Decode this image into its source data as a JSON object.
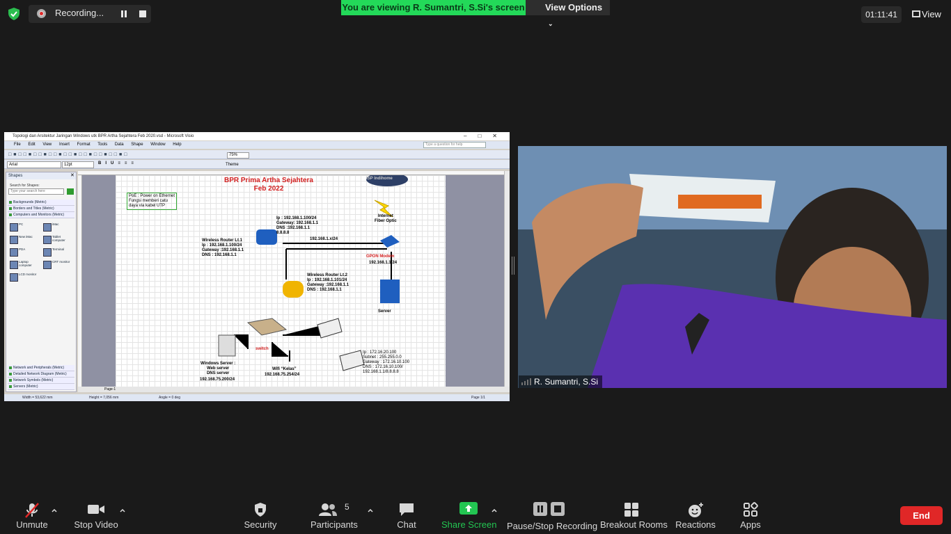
{
  "top_bar": {
    "recording_label": "Recording...",
    "viewing_banner": "You are viewing R. Sumantri, S.Si's screen",
    "view_options": "View Options",
    "timer": "01:11:41",
    "view_label": "View"
  },
  "shared_screen": {
    "window_title": "Topologi dan Arsitektur Jaringan Windows utk BPR Artha Sejahtera Feb 2020.vsd - Microsoft Visio",
    "menu": [
      "File",
      "Edit",
      "View",
      "Insert",
      "Format",
      "Tools",
      "Data",
      "Shape",
      "Window",
      "Help"
    ],
    "help_placeholder": "Type a question for help",
    "font_name": "Arial",
    "font_size": "12pt",
    "zoom": "75%",
    "theme_label": "Theme",
    "shapes_panel": {
      "title": "Shapes",
      "search_label": "Search for Shapes:",
      "search_placeholder": "Type your search here",
      "stencils_top": [
        "Backgrounds (Metric)",
        "Borders and Titles (Metric)",
        "Computers and Monitors (Metric)"
      ],
      "shapes": [
        "PC",
        "iMac",
        "New iMac",
        "Tablet computer",
        "PDA",
        "Terminal",
        "Laptop computer",
        "CRT monitor",
        "LCD monitor"
      ],
      "stencils_bottom": [
        "Network and Peripherals (Metric)",
        "Detailed Network Diagram (Metric)",
        "Network Symbols (Metric)",
        "Servers (Metric)"
      ]
    },
    "page_tab": "Page-1",
    "status": {
      "width": "Width = 53,622 mm",
      "height": "Height = 7,056 mm",
      "angle": "Angle = 0 deg",
      "page": "Page 1/1"
    },
    "diagram": {
      "title_line1": "BPR Prima Artha Sejahtera",
      "title_line2": "Feb 2022",
      "poe_note": "PoE : Power on Ethernet\nFungsi memberi catu\ndaya via kabel UTP",
      "isp_label": "ISP Indihome",
      "internet_label": "Internet\nFiber Optic",
      "router1_config": "Ip : 192.168.1.100/24\nGateway: 192.168.1.1\nDNS :192.168.1.1\n8.8.8.8",
      "router1_label": "Wireless Router Lt.1\nIp : 192.168.1.100/24\nGateway :192.168.1.1\nDNS : 192.168.1.1",
      "lan_label": "192.168.1.x/24",
      "gpon_label": "GPON Modem",
      "gpon_ip": "192.168.1.1/24",
      "router2_label": "Wireless Router Lt.2\nIp : 192.168.1.101/24\nGateway :192.168.1.1\nDNS : 192.168.1.1",
      "server_label": "Server",
      "switch_label": "switch",
      "win_server_label": "Windows Server :\nWeb server\nDNS server",
      "win_server_ip": "192.168.75.200/24",
      "wifi_label": "Wifi “Kelas”",
      "wifi_ip": "192.168.75.254/24",
      "laptop_config": "Ip : 172.16.20.100\nSubnet : 255.255.0.0\nGateway : 172.16.10.100\nDNS : 172.16.10.100/\n192.168.1.1/8.8.8.8"
    }
  },
  "video": {
    "participant_name": "R. Sumantri, S.Si"
  },
  "toolbar": {
    "unmute": "Unmute",
    "stop_video": "Stop Video",
    "security": "Security",
    "participants": "Participants",
    "participants_count": "5",
    "chat": "Chat",
    "share_screen": "Share Screen",
    "pause_recording": "Pause/Stop Recording",
    "breakout_rooms": "Breakout Rooms",
    "reactions": "Reactions",
    "apps": "Apps",
    "end": "End"
  },
  "colors": {
    "banner_green": "#23d959",
    "share_green": "#23c552",
    "end_red": "#e02727",
    "diagram_red": "#d32020"
  }
}
